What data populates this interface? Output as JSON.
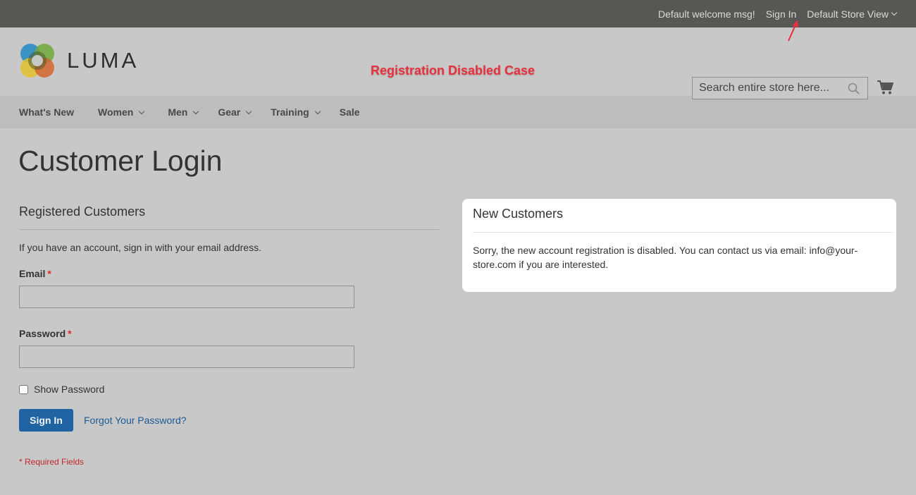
{
  "topbar": {
    "welcome": "Default welcome msg!",
    "sign_in": "Sign In",
    "store_view": "Default Store View"
  },
  "header": {
    "logo_text": "LUMA",
    "annotation": "Registration Disabled Case",
    "search_placeholder": "Search entire store here...",
    "colors": {
      "annotation": "#e8303d"
    }
  },
  "nav": {
    "items": [
      {
        "label": "What's New",
        "has_dropdown": false
      },
      {
        "label": "Women",
        "has_dropdown": true
      },
      {
        "label": "Men",
        "has_dropdown": true
      },
      {
        "label": "Gear",
        "has_dropdown": true
      },
      {
        "label": "Training",
        "has_dropdown": true
      },
      {
        "label": "Sale",
        "has_dropdown": false
      }
    ]
  },
  "page": {
    "title": "Customer Login"
  },
  "login": {
    "title": "Registered Customers",
    "intro": "If you have an account, sign in with your email address.",
    "email_label": "Email",
    "email_value": "",
    "password_label": "Password",
    "password_value": "",
    "required_mark": "*",
    "show_password_label": "Show Password",
    "show_password_checked": false,
    "sign_in_button": "Sign In",
    "forgot_link": "Forgot Your Password?",
    "required_note": "* Required Fields",
    "colors": {
      "button": "#1f63a3",
      "link": "#1c5a94",
      "required": "#e02b27"
    }
  },
  "new_customers": {
    "title": "New Customers",
    "message": "Sorry, the new account registration is disabled. You can contact us via email: info@your-store.com if you are interested."
  }
}
